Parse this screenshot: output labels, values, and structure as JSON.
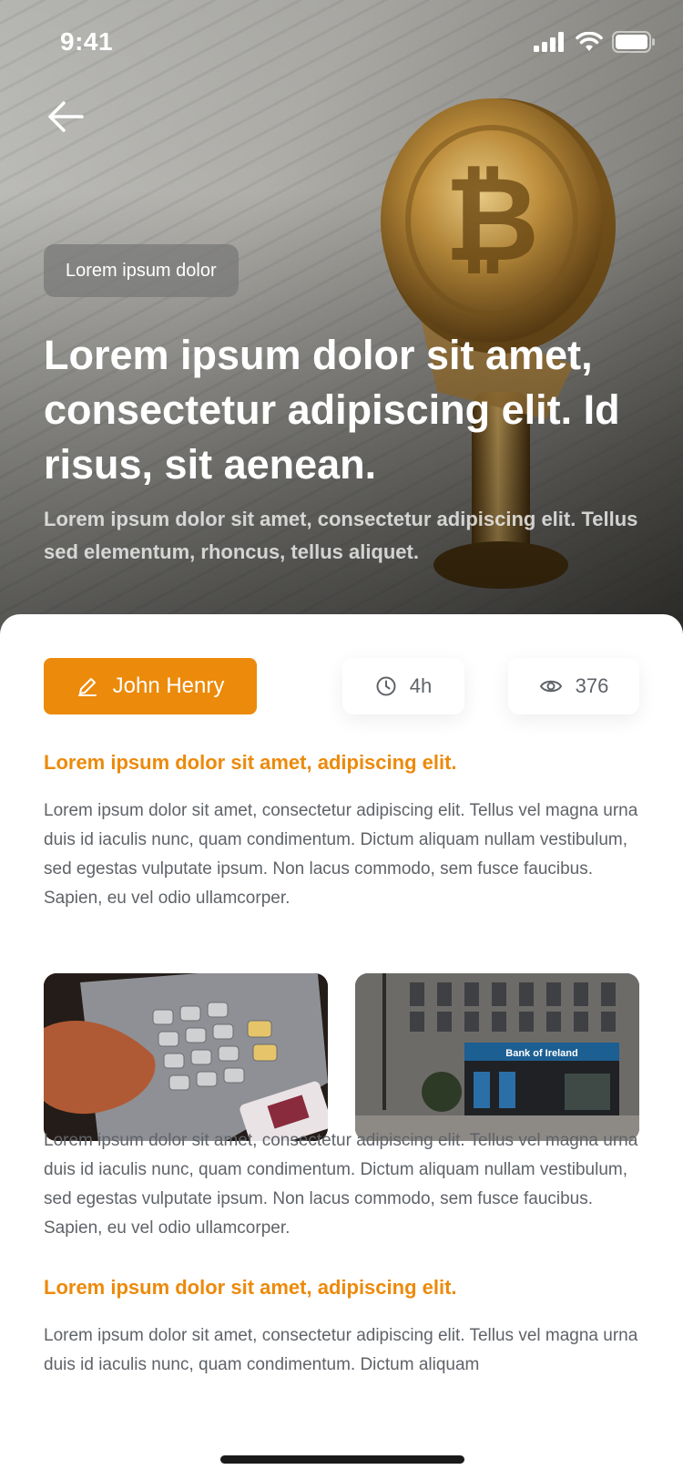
{
  "status_bar": {
    "time": "9:41",
    "icons": [
      "signal-icon",
      "wifi-icon",
      "battery-icon"
    ]
  },
  "hero": {
    "back_icon": "arrow-left-icon",
    "category": "Lorem ipsum dolor",
    "title": "Lorem ipsum dolor sit amet, consectetur adipiscing elit. Id risus, sit aenean.",
    "subtitle": "Lorem ipsum dolor sit amet, consectetur adipiscing elit. Tellus sed elementum, rhoncus, tellus aliquet."
  },
  "meta": {
    "author": "John Henry",
    "author_icon": "pencil-icon",
    "read_time": "4h",
    "read_time_icon": "clock-icon",
    "views": "376",
    "views_icon": "eye-icon"
  },
  "article": {
    "heading_1": "Lorem ipsum dolor sit amet, adipiscing elit.",
    "paragraph_1": "Lorem ipsum dolor sit amet, consectetur adipiscing elit. Tellus vel magna urna duis id iaculis nunc, quam condimentum. Dictum aliquam nullam vestibulum, sed egestas vulputate ipsum. Non lacus commodo, sem fusce faucibus. Sapien, eu vel odio ullamcorper.",
    "photo_right_sign": "Bank of Ireland",
    "paragraph_2": "Lorem ipsum dolor sit amet, consectetur adipiscing elit. Tellus vel magna urna duis id iaculis nunc, quam condimentum. Dictum aliquam nullam vestibulum, sed egestas vulputate ipsum. Non lacus commodo, sem fusce faucibus. Sapien, eu vel odio ullamcorper.",
    "heading_2": "Lorem ipsum dolor sit amet, adipiscing elit.",
    "paragraph_3": "Lorem ipsum dolor sit amet, consectetur adipiscing elit. Tellus vel magna urna duis id iaculis nunc, quam condimentum. Dictum aliquam"
  },
  "colors": {
    "accent": "#EC8A0B",
    "body_text": "#5f6368"
  }
}
